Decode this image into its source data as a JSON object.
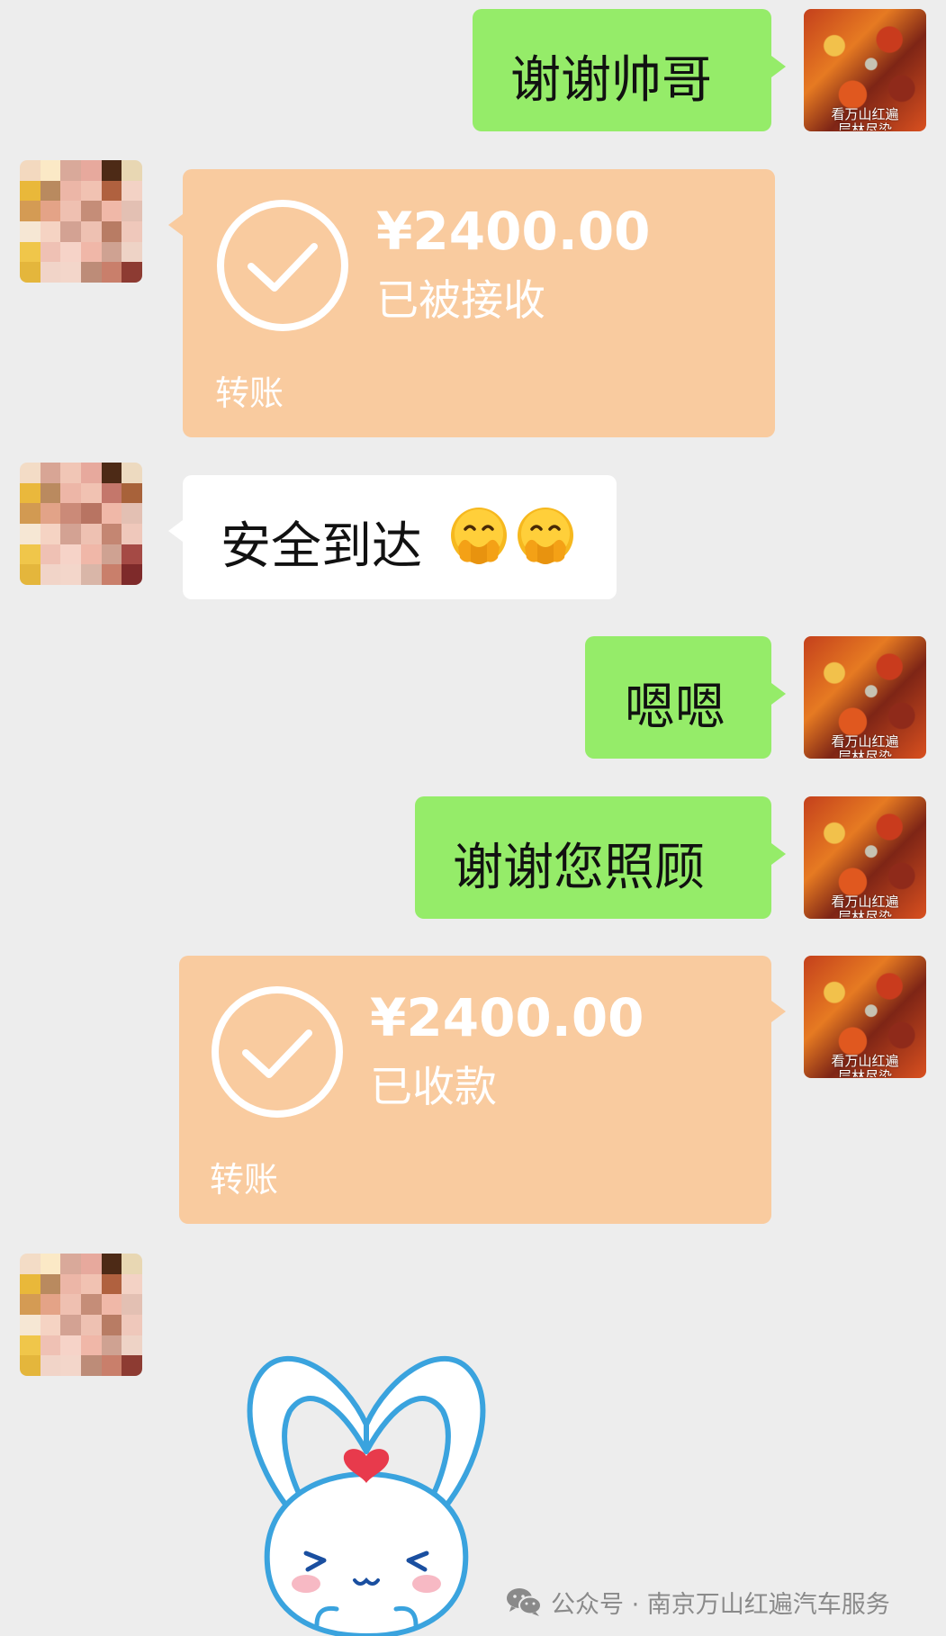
{
  "messages": [
    {
      "side": "right",
      "type": "text",
      "text": "谢谢帅哥"
    },
    {
      "side": "left",
      "type": "transfer",
      "amount": "¥2400.00",
      "status": "已被接收",
      "kind": "转账"
    },
    {
      "side": "left",
      "type": "text",
      "text": "安全到达"
    },
    {
      "side": "right",
      "type": "text",
      "text": "嗯嗯"
    },
    {
      "side": "right",
      "type": "text",
      "text": "谢谢您照顾"
    },
    {
      "side": "right",
      "type": "transfer",
      "amount": "¥2400.00",
      "status": "已收款",
      "kind": "转账"
    },
    {
      "side": "left",
      "type": "sticker",
      "sticker": "bunny-heart-sticker"
    }
  ],
  "my_avatar": {
    "caption_line1": "看万山红遍",
    "caption_line2": "层林尽染"
  },
  "emojis": [
    "face-with-hand-over-mouth-emoji",
    "face-with-hand-over-mouth-emoji"
  ],
  "watermark": {
    "text": "公众号 · 南京万山红遍汽车服务",
    "icon": "wechat-icon"
  },
  "colors": {
    "background": "#ededed",
    "sent_bubble": "#95ec69",
    "received_bubble": "#ffffff",
    "transfer_card": "#f9cb9f"
  }
}
